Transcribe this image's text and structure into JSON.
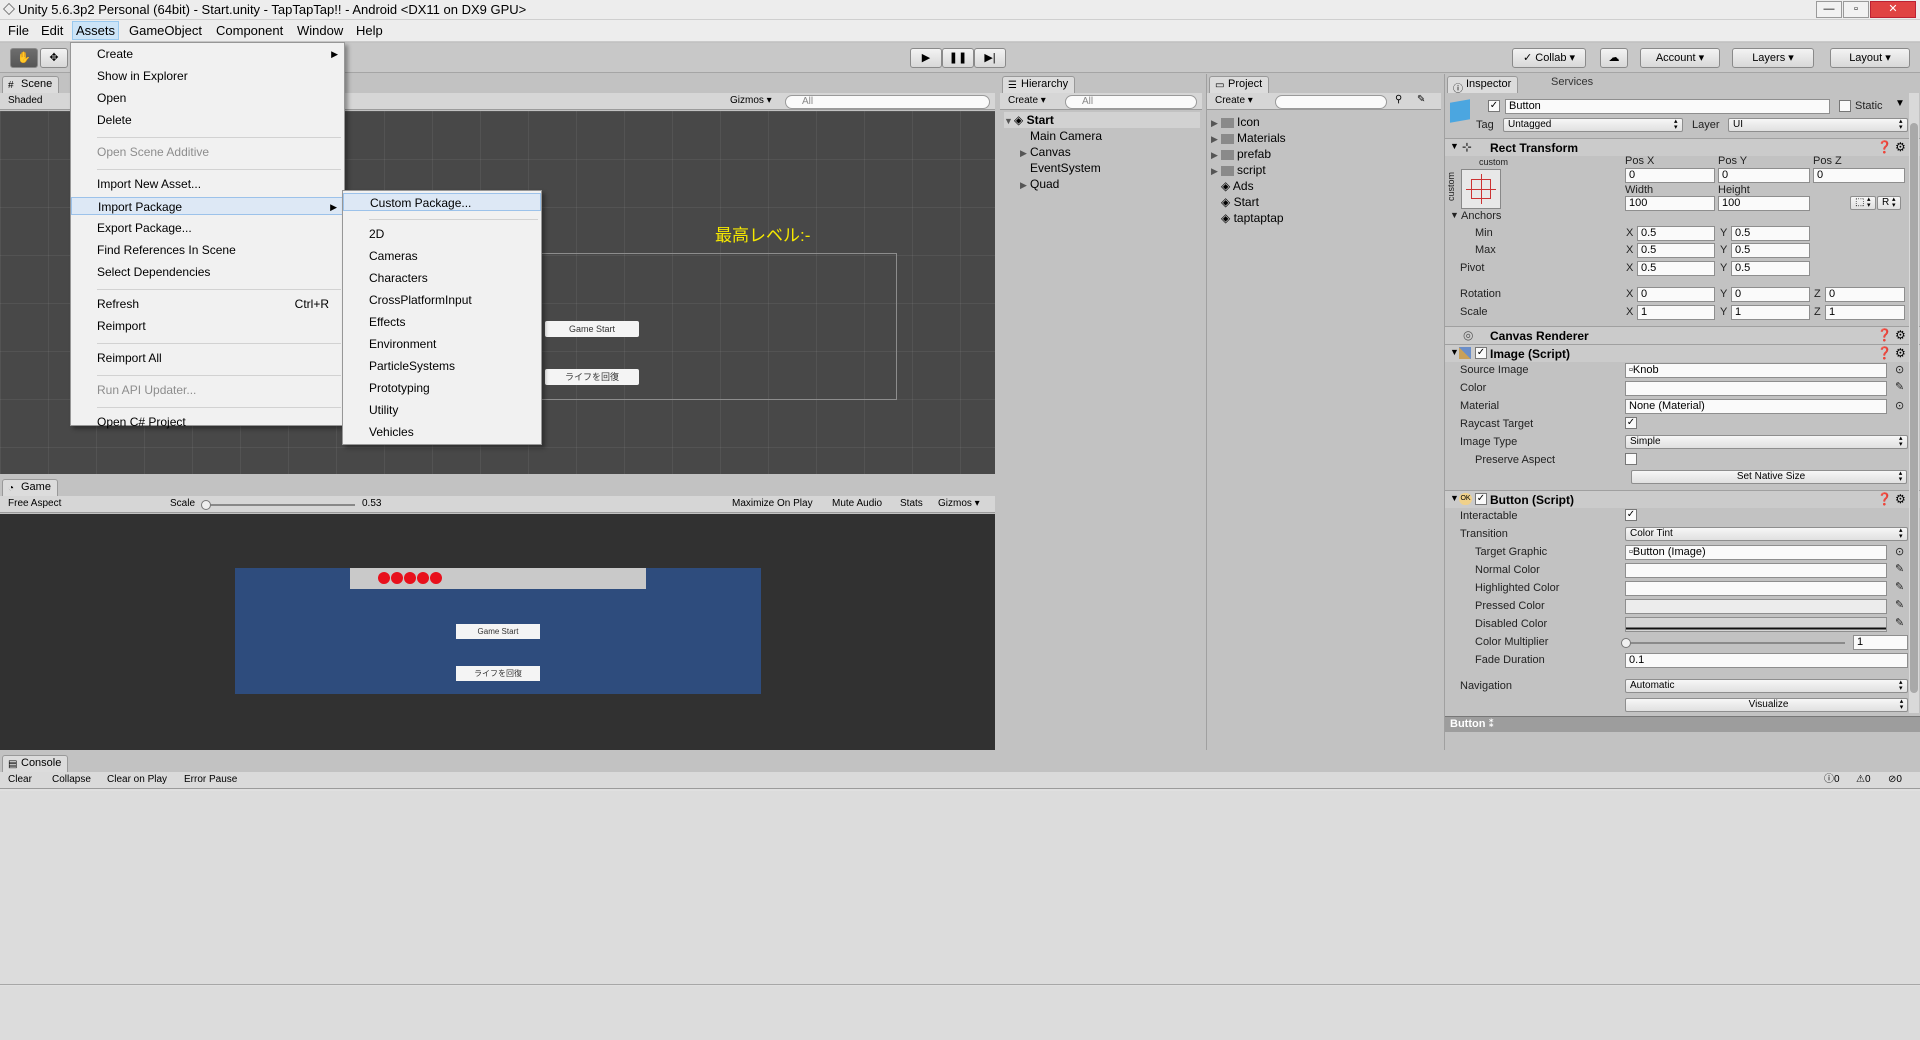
{
  "window": {
    "title": "Unity 5.6.3p2 Personal (64bit) - Start.unity - TapTapTap!! - Android <DX11 on DX9 GPU>"
  },
  "menubar": [
    "File",
    "Edit",
    "Assets",
    "GameObject",
    "Component",
    "Window",
    "Help"
  ],
  "toolbar": {
    "collab": "Collab",
    "account": "Account",
    "layers": "Layers",
    "layout": "Layout"
  },
  "scene": {
    "tab": "Scene",
    "shaded": "Shaded",
    "gizmos": "Gizmos",
    "search_placeholder": "All",
    "title_text": "最高レベル:-",
    "btn_start": "Game Start",
    "btn_life": "ライフを回復"
  },
  "game": {
    "tab": "Game",
    "aspect": "Free Aspect",
    "scale_label": "Scale",
    "scale_value": "0.53",
    "scale_fraction": 0.53,
    "maximize": "Maximize On Play",
    "mute": "Mute Audio",
    "stats": "Stats",
    "gizmos": "Gizmos",
    "btn_start": "Game Start",
    "btn_life": "ライフを回復"
  },
  "hierarchy": {
    "tab": "Hierarchy",
    "create": "Create",
    "search_placeholder": "All",
    "scene": "Start",
    "items": [
      {
        "name": "Main Camera",
        "expandable": false
      },
      {
        "name": "Canvas",
        "expandable": true
      },
      {
        "name": "EventSystem",
        "expandable": false
      },
      {
        "name": "Quad",
        "expandable": true
      }
    ]
  },
  "project": {
    "tab": "Project",
    "create": "Create",
    "items": [
      {
        "name": "Icon",
        "type": "folder"
      },
      {
        "name": "Materials",
        "type": "folder"
      },
      {
        "name": "prefab",
        "type": "folder"
      },
      {
        "name": "script",
        "type": "folder"
      },
      {
        "name": "Ads",
        "type": "scene"
      },
      {
        "name": "Start",
        "type": "scene"
      },
      {
        "name": "taptaptap",
        "type": "scene"
      }
    ]
  },
  "inspector": {
    "tab": "Inspector",
    "tab2": "Services",
    "object_name": "Button",
    "static": "Static",
    "tag_label": "Tag",
    "tag_value": "Untagged",
    "layer_label": "Layer",
    "layer_value": "UI",
    "rect": {
      "title": "Rect Transform",
      "anchor_preset": "custom",
      "posx_l": "Pos X",
      "posy_l": "Pos Y",
      "posz_l": "Pos Z",
      "posx": "0",
      "posy": "0",
      "posz": "0",
      "width_l": "Width",
      "height_l": "Height",
      "width": "100",
      "height": "100",
      "r_btn": "R",
      "anchors": "Anchors",
      "min": "Min",
      "max": "Max",
      "pivot": "Pivot",
      "min_x": "0.5",
      "min_y": "0.5",
      "max_x": "0.5",
      "max_y": "0.5",
      "pivot_x": "0.5",
      "pivot_y": "0.5",
      "rotation": "Rotation",
      "scale": "Scale",
      "rot_x": "0",
      "rot_y": "0",
      "rot_z": "0",
      "sc_x": "1",
      "sc_y": "1",
      "sc_z": "1",
      "x": "X",
      "y": "Y",
      "z": "Z"
    },
    "canvas_renderer": "Canvas Renderer",
    "image": {
      "title": "Image (Script)",
      "source_l": "Source Image",
      "source": "Knob",
      "color_l": "Color",
      "material_l": "Material",
      "material": "None (Material)",
      "raycast_l": "Raycast Target",
      "type_l": "Image Type",
      "type": "Simple",
      "preserve_l": "Preserve Aspect",
      "native_btn": "Set Native Size"
    },
    "button": {
      "title": "Button (Script)",
      "interact_l": "Interactable",
      "transition_l": "Transition",
      "transition": "Color Tint",
      "target_l": "Target Graphic",
      "target": "Button (Image)",
      "normal_l": "Normal Color",
      "highlight_l": "Highlighted Color",
      "pressed_l": "Pressed Color",
      "disabled_l": "Disabled Color",
      "mult_l": "Color Multiplier",
      "mult": "1",
      "fade_l": "Fade Duration",
      "fade": "0.1",
      "nav_l": "Navigation",
      "nav": "Automatic",
      "visualize": "Visualize"
    },
    "footer": "Button"
  },
  "console": {
    "tab": "Console",
    "buttons": [
      "Clear",
      "Collapse",
      "Clear on Play",
      "Error Pause"
    ],
    "counts": [
      "0",
      "0",
      "0"
    ]
  },
  "assets_menu": [
    {
      "label": "Create",
      "arrow": true
    },
    {
      "label": "Show in Explorer"
    },
    {
      "label": "Open"
    },
    {
      "label": "Delete"
    },
    {
      "sep": true
    },
    {
      "label": "Open Scene Additive",
      "disabled": true
    },
    {
      "sep": true
    },
    {
      "label": "Import New Asset..."
    },
    {
      "label": "Import Package",
      "arrow": true,
      "highlight": true
    },
    {
      "label": "Export Package..."
    },
    {
      "label": "Find References In Scene"
    },
    {
      "label": "Select Dependencies"
    },
    {
      "sep": true
    },
    {
      "label": "Refresh",
      "shortcut": "Ctrl+R"
    },
    {
      "label": "Reimport"
    },
    {
      "sep": true
    },
    {
      "label": "Reimport All"
    },
    {
      "sep": true
    },
    {
      "label": "Run API Updater...",
      "disabled": true
    },
    {
      "sep": true
    },
    {
      "label": "Open C# Project"
    }
  ],
  "import_submenu": [
    {
      "label": "Custom Package...",
      "highlight": true
    },
    {
      "sep": true
    },
    {
      "label": "2D"
    },
    {
      "label": "Cameras"
    },
    {
      "label": "Characters"
    },
    {
      "label": "CrossPlatformInput"
    },
    {
      "label": "Effects"
    },
    {
      "label": "Environment"
    },
    {
      "label": "ParticleSystems"
    },
    {
      "label": "Prototyping"
    },
    {
      "label": "Utility"
    },
    {
      "label": "Vehicles"
    }
  ],
  "colors": {
    "scene_bg": "#484848",
    "game_bg": "#313131",
    "canvas_blue": "#2e4c7d",
    "title_yellow": "#f5e800",
    "life_red": "#e8101c"
  }
}
